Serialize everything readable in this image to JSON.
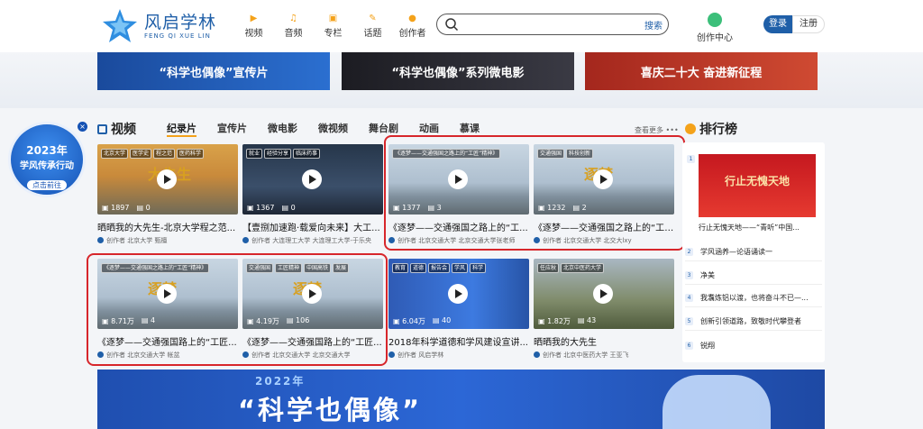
{
  "header": {
    "logo_cn": "风启学林",
    "logo_en": "FENG QI XUE LIN",
    "nav": [
      {
        "label": "视频",
        "icon": "video-icon"
      },
      {
        "label": "音频",
        "icon": "headphone-icon"
      },
      {
        "label": "专栏",
        "icon": "column-icon"
      },
      {
        "label": "话题",
        "icon": "topic-icon"
      },
      {
        "label": "创作者",
        "icon": "creator-icon"
      }
    ],
    "search_placeholder": "",
    "search_button": "搜索",
    "creator_center": "创作中心",
    "login": "登录",
    "register": "注册"
  },
  "banners": [
    {
      "text": "“科学也偶像”宣传片"
    },
    {
      "text": "“科学也偶像”系列微电影"
    },
    {
      "text": "喜庆二十大 奋进新征程"
    }
  ],
  "promo": {
    "line1": "2023年",
    "line2": "学风传承行动",
    "button": "点击前往"
  },
  "video": {
    "title": "视频",
    "tabs": [
      "纪录片",
      "宣传片",
      "微电影",
      "微视频",
      "舞台剧",
      "动画",
      "慕课"
    ],
    "more": "查看更多 •••",
    "cards": [
      {
        "title": "晒晒我的大先生-北京大学程之范...",
        "meta": "创作者 北京大学 甄檀",
        "views": "1897",
        "comments": "0",
        "tags": [
          "北京大学",
          "医学史",
          "程之范",
          "医药科学"
        ],
        "thumb": "campus",
        "art": "大先生"
      },
      {
        "title": "【壹捌加速跑·载爱向未来】大工...",
        "meta": "创作者 大连理工大学 大连理工大学-于乐央",
        "views": "1367",
        "comments": "0",
        "tags": [
          "就业",
          "经验分享",
          "临床药事"
        ],
        "thumb": "meeting",
        "art": ""
      },
      {
        "title": "《逐梦——交通强国之路上的“工...",
        "meta": "创作者 北京交通大学 北京交通大学张老师",
        "views": "1377",
        "comments": "3",
        "tags": [
          "《逐梦——交通强国之路上的“工匠”精神》"
        ],
        "thumb": "city",
        "art": ""
      },
      {
        "title": "《逐梦——交通强国之路上的“工匠...",
        "meta": "创作者 北京交通大学 北交大lxy",
        "views": "1232",
        "comments": "2",
        "tags": [
          "交通强国",
          "科技创新"
        ],
        "thumb": "city",
        "art": "逐梦"
      },
      {
        "title": "《逐梦——交通强国路上的“工匠...",
        "meta": "创作者 北京交通大学 帐盆",
        "views": "8.71万",
        "comments": "4",
        "tags": [
          "《逐梦——交通强国之路上的“工匠”精神》"
        ],
        "thumb": "city",
        "art": "逐梦"
      },
      {
        "title": "《逐梦——交通强国路上的“工匠...",
        "meta": "创作者 北京交通大学 北京交通大学",
        "views": "4.19万",
        "comments": "106",
        "tags": [
          "交通强国",
          "工匠精神",
          "中国高铁",
          "发展"
        ],
        "thumb": "city",
        "art": "逐梦"
      },
      {
        "title": "2018年科学道德和学风建设宣讲...",
        "meta": "创作者 风启学林",
        "views": "6.04万",
        "comments": "40",
        "tags": [
          "教育",
          "道德",
          "报告会",
          "学风",
          "科学"
        ],
        "thumb": "studio",
        "art": ""
      },
      {
        "title": "晒晒我的大先生",
        "meta": "创作者 北京中医药大学 王亚飞",
        "views": "1.82万",
        "comments": "43",
        "tags": [
          "任应秋",
          "北京中医药大学"
        ],
        "thumb": "garden",
        "art": ""
      }
    ]
  },
  "ranking": {
    "title": "排行榜",
    "cover_text": "行止无愧天地",
    "items": [
      {
        "num": "1",
        "text": "行止无愧天地——“青听”中国..."
      },
      {
        "num": "2",
        "text": "学风涵养—论语诵读一"
      },
      {
        "num": "3",
        "text": "净美"
      },
      {
        "num": "4",
        "text": "我翥炼铝以渡，也将奋斗不已—..."
      },
      {
        "num": "5",
        "text": "创新引领道路，致敬时代攀登者"
      },
      {
        "num": "6",
        "text": "锐翔"
      }
    ]
  },
  "bottom_banner": {
    "year": "2022年",
    "title": "“科学也偶像”"
  }
}
